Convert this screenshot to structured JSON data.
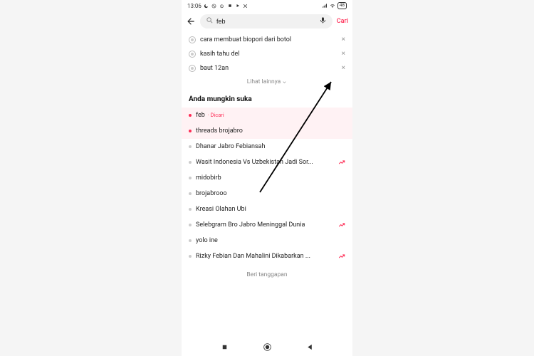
{
  "status": {
    "time": "13:06",
    "battery": "48"
  },
  "search": {
    "value": "feb",
    "action_label": "Cari"
  },
  "history": {
    "items": [
      {
        "text": "cara membuat biopori dari botol"
      },
      {
        "text": "kasih tahu del"
      },
      {
        "text": "baut 12an"
      }
    ],
    "see_more_label": "Lihat lainnya"
  },
  "suggestions": {
    "title": "Anda mungkin suka",
    "searched_badge": "Dicari",
    "items": [
      {
        "text": "feb",
        "hot": true,
        "searched": true,
        "trending": false
      },
      {
        "text": "threads brojabro",
        "hot": true,
        "searched": false,
        "trending": false
      },
      {
        "text": "Dhanar Jabro Febiansah",
        "hot": false,
        "searched": false,
        "trending": false
      },
      {
        "text": "Wasit Indonesia Vs Uzbekistan Jadi Sor...",
        "hot": false,
        "searched": false,
        "trending": true
      },
      {
        "text": "midobirb",
        "hot": false,
        "searched": false,
        "trending": false
      },
      {
        "text": "brojabrooo",
        "hot": false,
        "searched": false,
        "trending": false
      },
      {
        "text": "Kreasi Olahan Ubi",
        "hot": false,
        "searched": false,
        "trending": false
      },
      {
        "text": "Selebgram Bro Jabro Meninggal Dunia",
        "hot": false,
        "searched": false,
        "trending": true
      },
      {
        "text": "yolo ine",
        "hot": false,
        "searched": false,
        "trending": false
      },
      {
        "text": "Rizky Febian Dan Mahalini Dikabarkan ...",
        "hot": false,
        "searched": false,
        "trending": true
      }
    ],
    "feedback_label": "Beri tanggapan"
  },
  "colors": {
    "accent": "#fe2c55"
  }
}
